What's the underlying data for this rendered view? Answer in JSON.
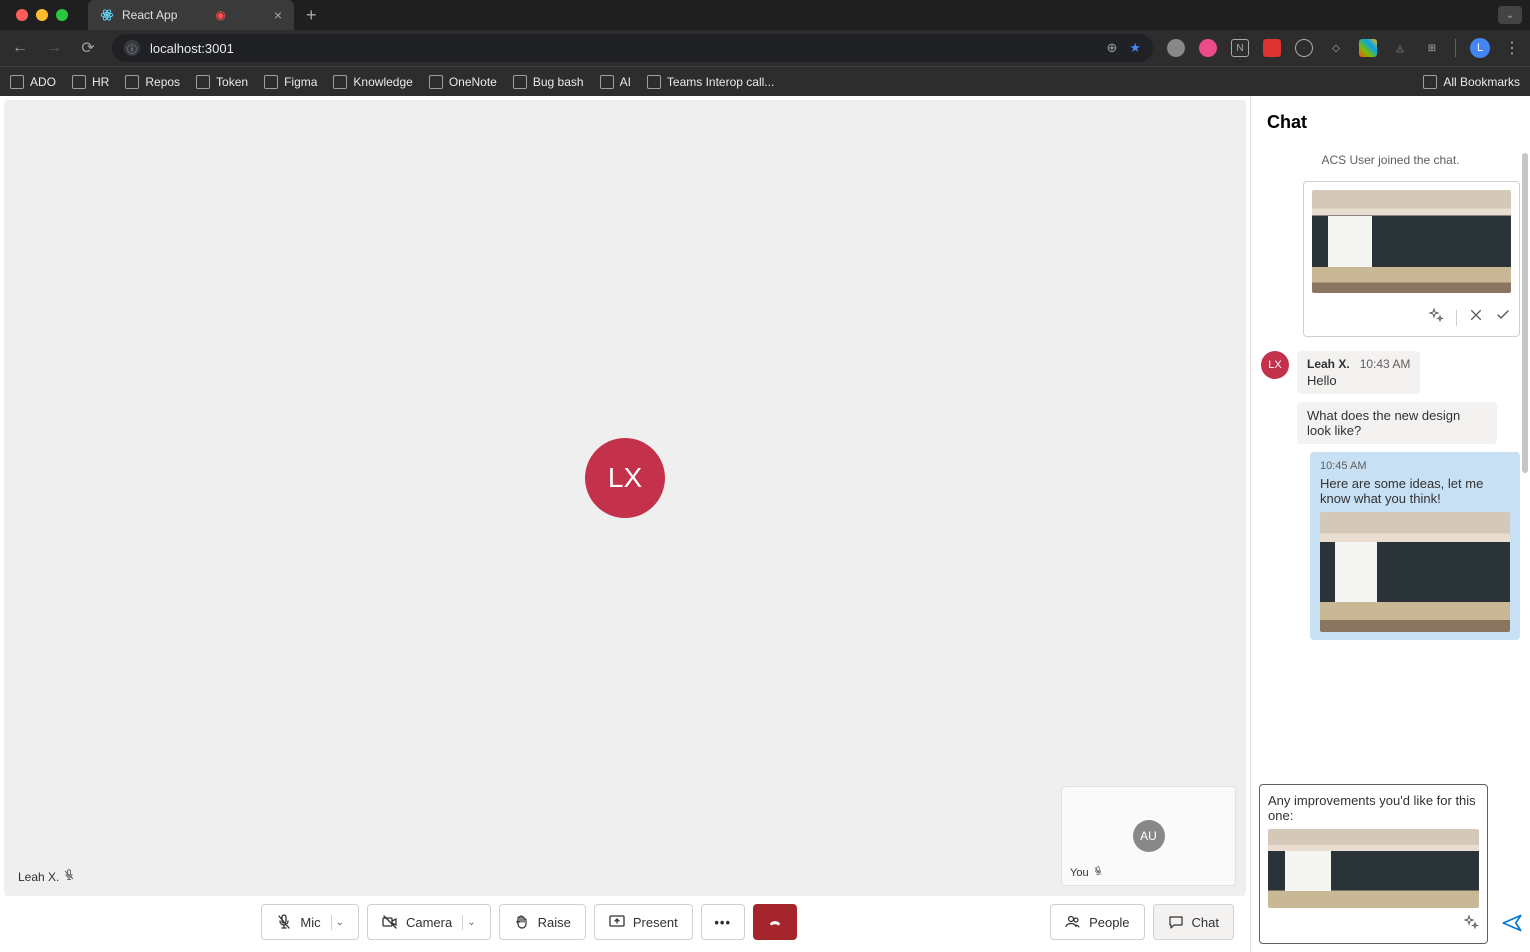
{
  "browser": {
    "tab_title": "React App",
    "url": "localhost:3001",
    "bookmarks": [
      "ADO",
      "HR",
      "Repos",
      "Token",
      "Figma",
      "Knowledge",
      "OneNote",
      "Bug bash",
      "AI",
      "Teams Interop call..."
    ],
    "all_bookmarks": "All Bookmarks",
    "profile_initial": "L"
  },
  "video": {
    "main_initials": "LX",
    "main_name": "Leah X.",
    "pip_initials": "AU",
    "pip_name": "You"
  },
  "controls": {
    "mic": "Mic",
    "camera": "Camera",
    "raise": "Raise",
    "present": "Present",
    "people": "People",
    "chat": "Chat"
  },
  "chat": {
    "title": "Chat",
    "system_msg": "ACS User joined the chat.",
    "leah": {
      "initials": "LX",
      "name": "Leah X.",
      "time": "10:43 AM",
      "msg1": "Hello",
      "msg2": "What does the new design look like?"
    },
    "out": {
      "time": "10:45 AM",
      "text": "Here are some ideas, let me know what you think!"
    },
    "compose_text": "Any improvements you'd like for this one:"
  }
}
